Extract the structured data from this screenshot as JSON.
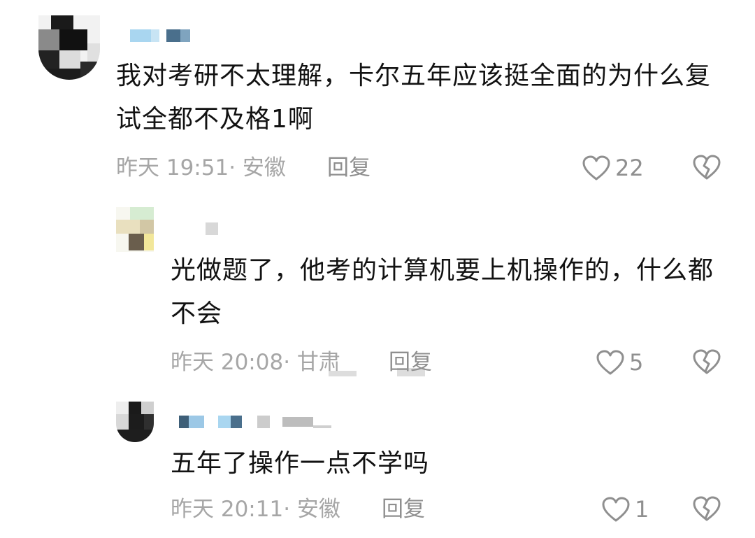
{
  "comments": [
    {
      "text": "我对考研不太理解，卡尔五年应该挺全面的为什么复试全都不及格1啊",
      "time": "昨天 19:51",
      "location": "安徽",
      "reply_label": "回复",
      "likes": "22"
    },
    {
      "text": "光做题了，他考的计算机要上机操作的，什么都不会",
      "time": "昨天 20:08",
      "location": "甘肃",
      "reply_label": "回复",
      "likes": "5"
    },
    {
      "text": "五年了操作一点不学吗",
      "time": "昨天 20:11",
      "location": "安徽",
      "reply_label": "回复",
      "likes": "1"
    }
  ],
  "meta_separator": "·",
  "icons": {
    "like": "heart-outline-icon",
    "dislike": "broken-heart-icon"
  },
  "colors": {
    "text": "#121212",
    "meta": "#a6a6a6",
    "icon": "#8f8f8f"
  }
}
